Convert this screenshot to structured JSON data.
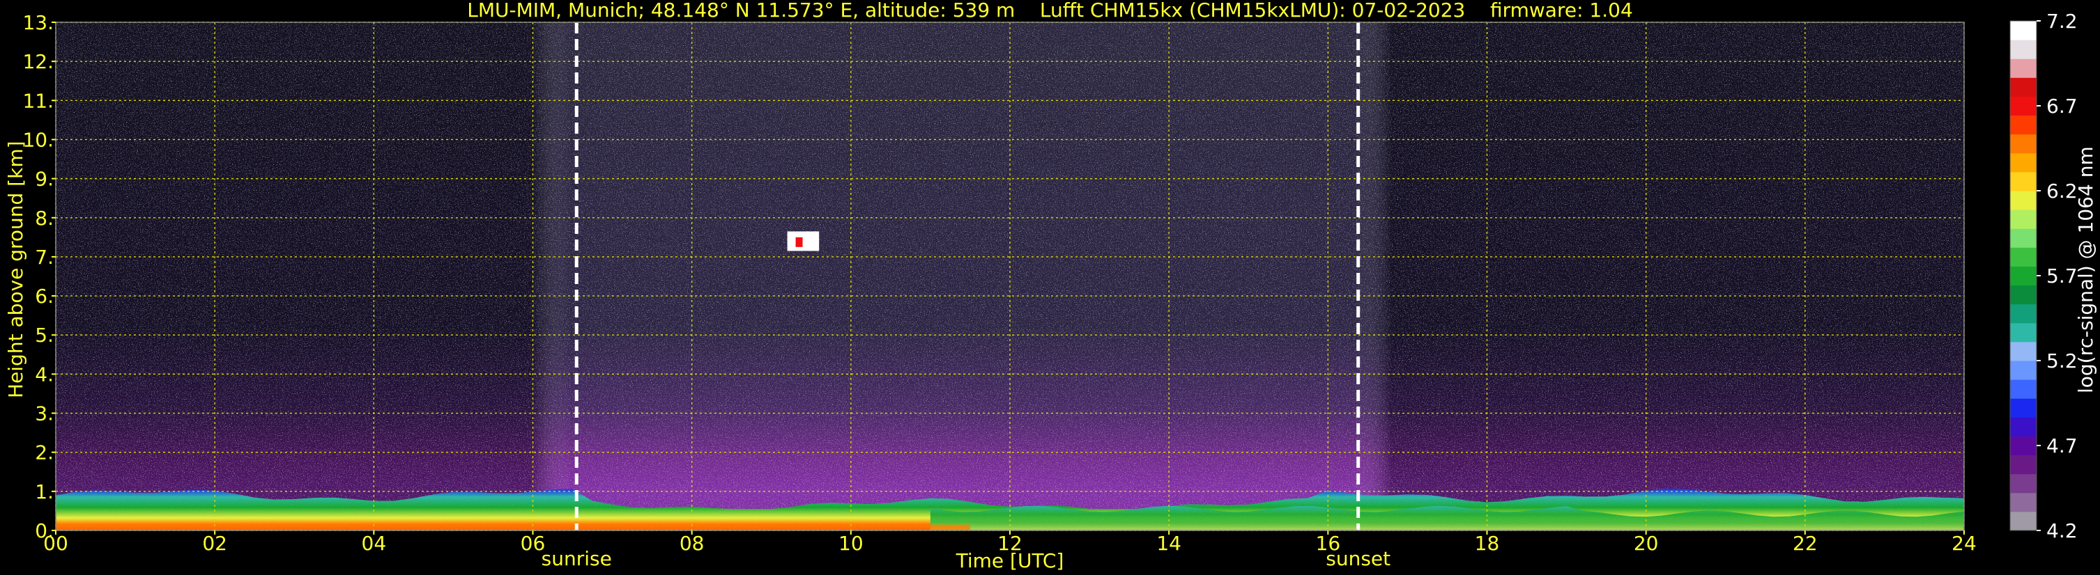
{
  "header": {
    "title": "LMU-MIM, Munich; 48.148° N 11.573° E, altitude: 539 m    Lufft CHM15kx (CHM15kxLMU): 07-02-2023    firmware: 1.04"
  },
  "colors": {
    "text": "#ffff33",
    "grid": "#d8d800",
    "background": "#000000",
    "marker_lines": "#ffffff"
  },
  "chart_data": {
    "type": "heatmap",
    "title": "LMU-MIM, Munich; 48.148° N 11.573° E, altitude: 539 m    Lufft CHM15kx (CHM15kxLMU): 07-02-2023    firmware: 1.04",
    "xlabel": "Time [UTC]",
    "ylabel": "Height above ground [km]",
    "xlim": [
      0,
      24
    ],
    "ylim": [
      0,
      13
    ],
    "x_ticks": [
      "00",
      "02",
      "04",
      "06",
      "08",
      "10",
      "12",
      "14",
      "16",
      "18",
      "20",
      "22",
      "24"
    ],
    "y_ticks": [
      "0.",
      "1.",
      "2.",
      "3.",
      "4.",
      "5.",
      "6.",
      "7.",
      "8.",
      "9.",
      "10.",
      "11.",
      "12.",
      "13."
    ],
    "grid": true,
    "annotations": [
      {
        "label": "sunrise",
        "x": 6.55
      },
      {
        "label": "sunset",
        "x": 16.38
      }
    ],
    "colorbar": {
      "label": "log(rc-signal) @ 1064 nm",
      "range": [
        4.2,
        7.2
      ],
      "ticks": [
        "7.2",
        "6.7",
        "6.2",
        "5.7",
        "5.2",
        "4.7",
        "4.2"
      ],
      "palette": [
        "#a09aa6",
        "#8e6b9c",
        "#7a3c8e",
        "#6a1a86",
        "#5c0a9e",
        "#3a10c8",
        "#1a28f0",
        "#3c66ff",
        "#6a96ff",
        "#94b8f6",
        "#2eb8a8",
        "#11a07a",
        "#0a8c3c",
        "#18a830",
        "#3cc040",
        "#7ae070",
        "#b0f060",
        "#e8f040",
        "#ffd21e",
        "#ffa800",
        "#ff7a00",
        "#ff3c00",
        "#f01010",
        "#d81010",
        "#e8a0a8",
        "#e6e0e4",
        "#ffffff"
      ]
    },
    "features": {
      "boundary_layer_top_km": 0.9,
      "aerosol_layer_top_km": 2.0,
      "cloud": {
        "time_start": 9.2,
        "time_end": 9.6,
        "height_km": 7.4
      }
    }
  }
}
